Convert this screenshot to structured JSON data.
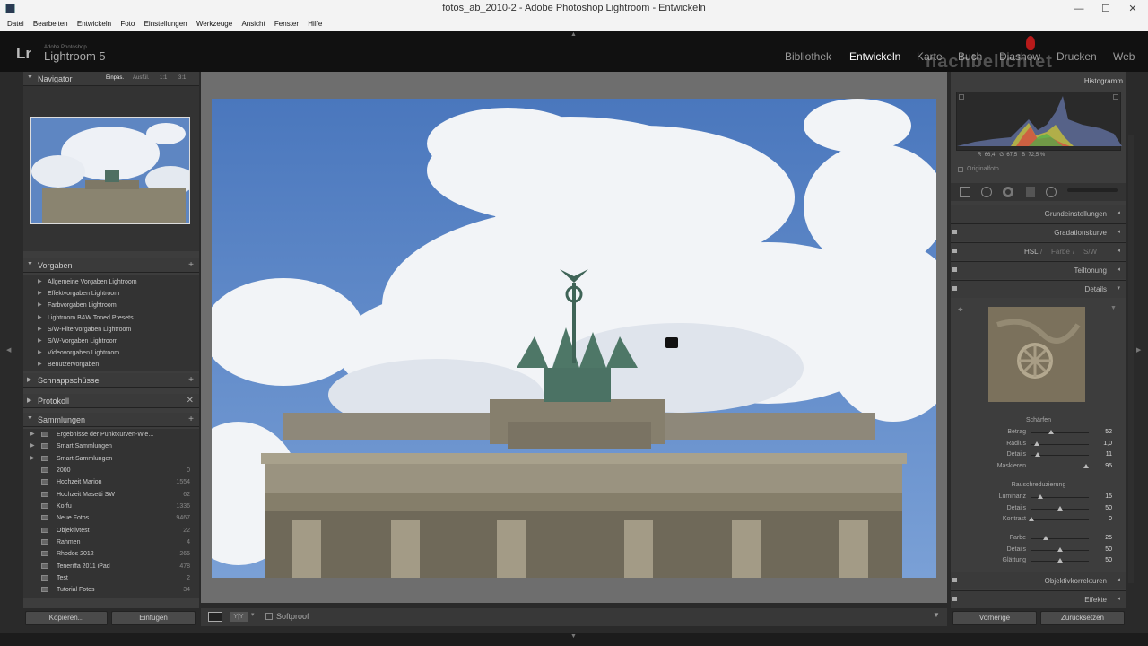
{
  "window": {
    "title": "fotos_ab_2010-2 - Adobe Photoshop Lightroom - Entwickeln"
  },
  "menu": [
    "Datei",
    "Bearbeiten",
    "Entwickeln",
    "Foto",
    "Einstellungen",
    "Werkzeuge",
    "Ansicht",
    "Fenster",
    "Hilfe"
  ],
  "brand": {
    "small": "Adobe Photoshop",
    "name": "Lightroom 5",
    "logo": "Lr"
  },
  "modules": [
    {
      "label": "Bibliothek",
      "active": false
    },
    {
      "label": "Entwickeln",
      "active": true
    },
    {
      "label": "Karte",
      "active": false
    },
    {
      "label": "Buch",
      "active": false
    },
    {
      "label": "Diashow",
      "active": false
    },
    {
      "label": "Drucken",
      "active": false
    },
    {
      "label": "Web",
      "active": false
    }
  ],
  "watermark": {
    "text": "nachbelichtet",
    "sub": "Histogramm"
  },
  "navigator": {
    "title": "Navigator",
    "zoom": [
      "Einpas.",
      "Ausfül.",
      "1:1",
      "3:1"
    ]
  },
  "presets": {
    "title": "Vorgaben",
    "items": [
      "Allgemeine Vorgaben Lightroom",
      "Effektvorgaben Lightroom",
      "Farbvorgaben Lightroom",
      "Lightroom B&W Toned Presets",
      "S/W-Filtervorgaben Lightroom",
      "S/W-Vorgaben Lightroom",
      "Videovorgaben Lightroom",
      "Benutzervorgaben"
    ]
  },
  "snapshots": {
    "title": "Schnappschüsse"
  },
  "history": {
    "title": "Protokoll"
  },
  "collections": {
    "title": "Sammlungen",
    "groups": [
      "Ergebnisse der Punktkurven-Wie...",
      "Smart Sammlungen",
      "Smart-Sammlungen"
    ],
    "items": [
      {
        "name": "2000",
        "count": "0"
      },
      {
        "name": "Hochzeit Marion",
        "count": "1554"
      },
      {
        "name": "Hochzeit Masetti SW",
        "count": "62"
      },
      {
        "name": "Korfu",
        "count": "1336"
      },
      {
        "name": "Neue Fotos",
        "count": "9467"
      },
      {
        "name": "Objektivtest",
        "count": "22"
      },
      {
        "name": "Rahmen",
        "count": "4"
      },
      {
        "name": "Rhodos 2012",
        "count": "265"
      },
      {
        "name": "Teneriffa 2011 iPad",
        "count": "478"
      },
      {
        "name": "Test",
        "count": "2"
      },
      {
        "name": "Tutorial Fotos",
        "count": "34"
      }
    ]
  },
  "left_buttons": {
    "copy": "Kopieren...",
    "paste": "Einfügen"
  },
  "toolbar": {
    "softproof": "Softproof",
    "yy": "Y|Y"
  },
  "histogram": {
    "rgb_r_label": "R",
    "rgb_r": "66,4",
    "rgb_g_label": "G",
    "rgb_g": "67,5",
    "rgb_b_label": "B",
    "rgb_b": "72,5",
    "unit": "%",
    "original": "Originalfoto"
  },
  "right_sections": {
    "basic": "Grundeinstellungen",
    "curve": "Gradationskurve",
    "hsl": "HSL",
    "color": "Farbe",
    "bw": "S/W",
    "split": "Teiltonung",
    "details": "Details",
    "lens": "Objektivkorrekturen",
    "effects": "Effekte"
  },
  "sharpening": {
    "title": "Schärfen",
    "sliders": [
      {
        "label": "Betrag",
        "value": "52",
        "pct": 0.35
      },
      {
        "label": "Radius",
        "value": "1,0",
        "pct": 0.1
      },
      {
        "label": "Details",
        "value": "11",
        "pct": 0.11
      },
      {
        "label": "Maskieren",
        "value": "95",
        "pct": 0.95
      }
    ]
  },
  "noise": {
    "title": "Rauschreduzierung",
    "sliders": [
      {
        "label": "Luminanz",
        "value": "15",
        "pct": 0.15
      },
      {
        "label": "Details",
        "value": "50",
        "pct": 0.5
      },
      {
        "label": "Kontrast",
        "value": "0",
        "pct": 0.0
      },
      {
        "label": "Farbe",
        "value": "25",
        "pct": 0.25
      },
      {
        "label": "Details",
        "value": "50",
        "pct": 0.5
      },
      {
        "label": "Glättung",
        "value": "50",
        "pct": 0.5
      }
    ]
  },
  "right_buttons": {
    "prev": "Vorherige",
    "reset": "Zurücksetzen"
  }
}
